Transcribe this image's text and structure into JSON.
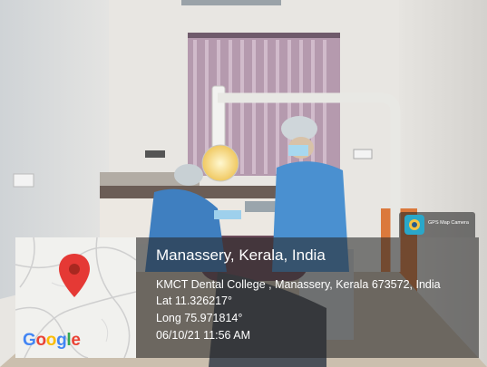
{
  "location": {
    "title": "Manassery, Kerala, India",
    "address": "KMCT Dental College , Manassery, Kerala 673572, India",
    "lat": "Lat 11.326217°",
    "long": "Long 75.971814°",
    "datetime": "06/10/21 11:56 AM"
  },
  "badge": {
    "label": "GPS Map Camera",
    "icon": "gps-camera-app-icon"
  },
  "map": {
    "brand": [
      "G",
      "o",
      "o",
      "g",
      "l",
      "e"
    ],
    "brand_colors": [
      "#4285F4",
      "#EA4335",
      "#FBBC05",
      "#4285F4",
      "#34A853",
      "#EA4335"
    ],
    "pin_color": "#E53935"
  }
}
